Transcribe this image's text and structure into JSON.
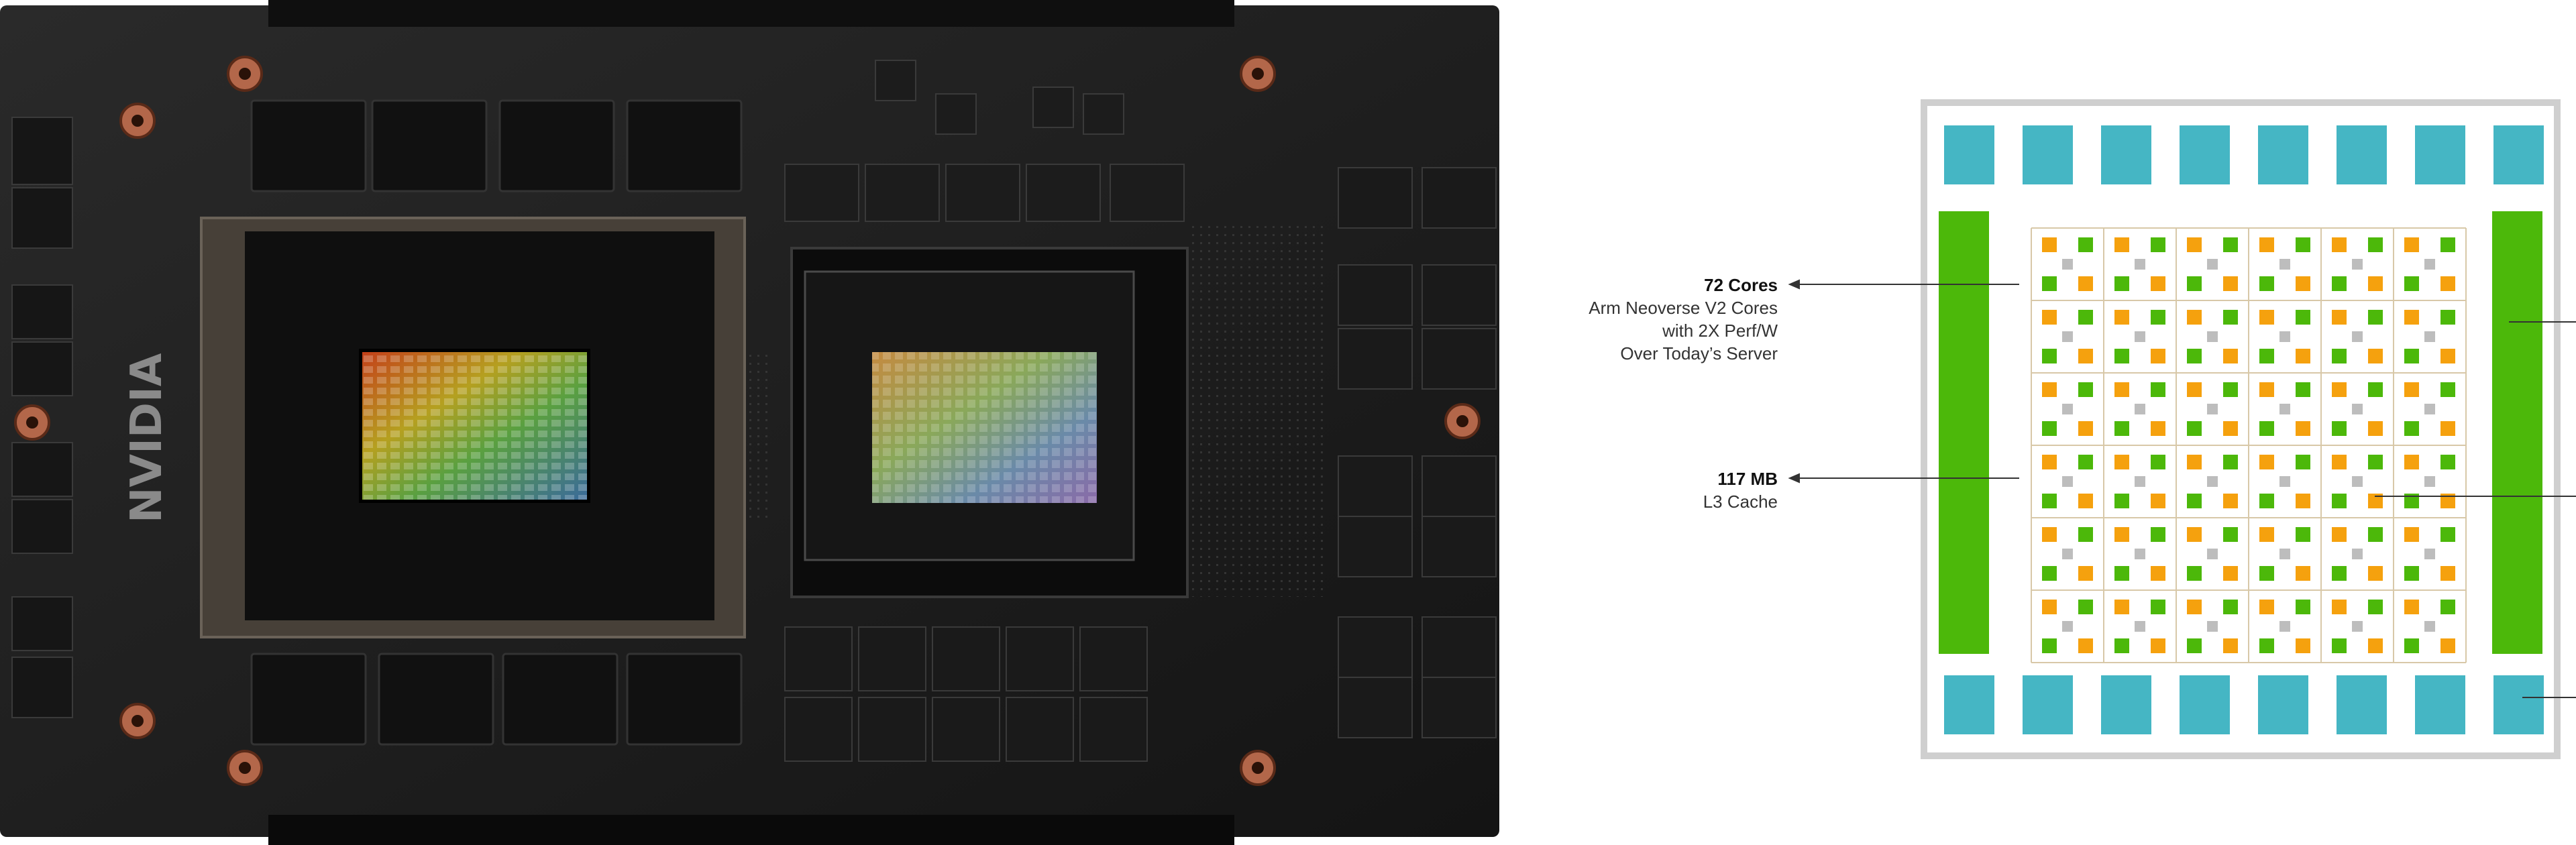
{
  "board": {
    "brand_text": "NVIDIA"
  },
  "callouts": {
    "cores": {
      "title": "72 Cores",
      "lines": [
        "Arm Neoverse V2 Cores",
        "with 2X Perf/W",
        "Over Today’s Server"
      ]
    },
    "cache": {
      "title": "117 MB",
      "lines": [
        "L3 Cache"
      ]
    }
  },
  "colors": {
    "frame": "#cfcfcf",
    "memory_block": "#45b6c4",
    "side_bar": "#4cb80a",
    "core": "#f5a10e",
    "cache": "#4cb80a",
    "mesh_node": "#bdbdbd"
  }
}
